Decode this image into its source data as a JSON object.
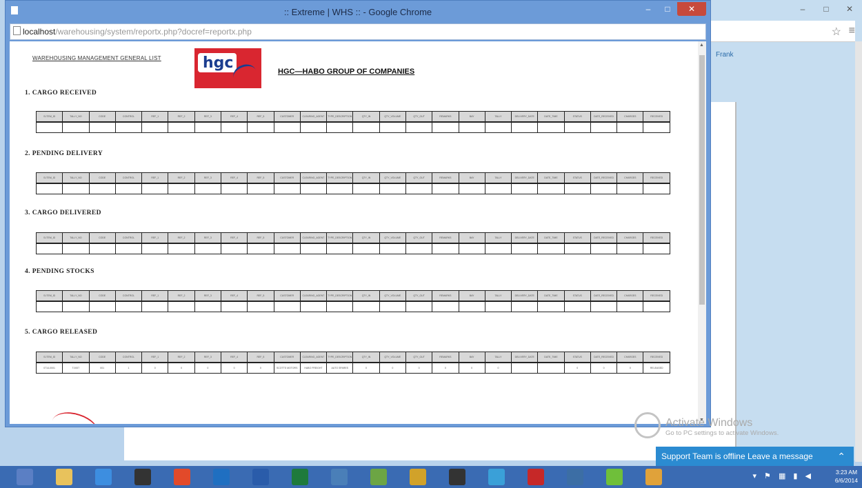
{
  "browser": {
    "window_title": ":: Extreme | WHS :: - Google Chrome",
    "url_host": "localhost",
    "url_path": "/warehousing/system/reportx.php?docref=reportx.php",
    "controls": {
      "minimize": "–",
      "maximize": "□",
      "close": "✕"
    }
  },
  "background_window": {
    "controls": [
      "–",
      "□",
      "✕"
    ],
    "star": "☆",
    "menu": "≡",
    "user_name": "Frank"
  },
  "report": {
    "heading": "WAREHOUSING MANAGEMENT GENERAL LIST",
    "logo_text": "hgc",
    "company_name": "HGC—HABO GROUP OF COMPANIES",
    "columns": [
      "S.ITEM_ID",
      "TALLY_NO",
      "CODE",
      "CONTROL",
      "REF_1",
      "REF_2",
      "REF_3",
      "REF_4",
      "REF_5",
      "CUSTOMER",
      "CLEARING_AGENT",
      "TYPE_DESCRIPTION",
      "QTY_IN",
      "QTY_VOLUME",
      "QTY_OUT",
      "REMARKS",
      "BAY",
      "TALLY",
      "DELIVERY_DATE",
      "DATE_TIME",
      "STATUS",
      "DATE_RECEIVED",
      "CHARGES",
      "RECEIVED"
    ],
    "sections": [
      {
        "title": "1. CARGO RECEIVED",
        "rows": [
          [
            "",
            "",
            "",
            "",
            "",
            "",
            "",
            "",
            "",
            "",
            "",
            "",
            "",
            "",
            "",
            "",
            "",
            "",
            "",
            "",
            "",
            "",
            "",
            ""
          ]
        ]
      },
      {
        "title": "2. PENDING DELIVERY",
        "rows": [
          [
            "",
            "",
            "",
            "",
            "",
            "",
            "",
            "",
            "",
            "",
            "",
            "",
            "",
            "",
            "",
            "",
            "",
            "",
            "",
            "",
            "",
            "",
            "",
            ""
          ]
        ]
      },
      {
        "title": "3. CARGO DELIVERED",
        "rows": [
          [
            "",
            "",
            "",
            "",
            "",
            "",
            "",
            "",
            "",
            "",
            "",
            "",
            "",
            "",
            "",
            "",
            "",
            "",
            "",
            "",
            "",
            "",
            "",
            ""
          ]
        ]
      },
      {
        "title": "4. PENDING STOCKS",
        "rows": [
          [
            "",
            "",
            "",
            "",
            "",
            "",
            "",
            "",
            "",
            "",
            "",
            "",
            "",
            "",
            "",
            "",
            "",
            "",
            "",
            "",
            "",
            "",
            "",
            ""
          ]
        ]
      },
      {
        "title": "5. CARGO RELEASED",
        "rows": [
          [
            "0714-0001",
            "T.0007",
            "001",
            "1",
            "0",
            "0",
            "0",
            "0",
            "0",
            "SCOTTS MOTORS",
            "HABO FREIGHT",
            "AUTO SPARES",
            "0",
            "0",
            "0",
            "0",
            "0",
            "0",
            "",
            "",
            "0",
            "0",
            "0",
            "RELEASED"
          ]
        ]
      }
    ]
  },
  "watermark": {
    "title": "Activate Windows",
    "subtitle": "Go to PC settings to activate Windows."
  },
  "support_bar": {
    "text": "Support Team is offline Leave a message",
    "arrow": "⌃"
  },
  "taskbar": {
    "apps": [
      "windows-explorer",
      "file-manager",
      "internet-explorer",
      "command-prompt",
      "chrome",
      "outlook",
      "word",
      "excel",
      "network-tool",
      "paint",
      "checklist",
      "terminal",
      "browser-app",
      "filezilla",
      "visio",
      "browser-alt",
      "people"
    ],
    "tray": "▾ ⚑ ▦ ▮ ◀",
    "time": "3:23 AM",
    "date": "6/6/2014"
  },
  "colors": {
    "popup_frame": "#6c9bd8",
    "close_button": "#c74a3c",
    "logo_red": "#d92630",
    "logo_blue": "#1b3d8f",
    "taskbar": "#3a6bb3",
    "support": "#2b8bd1"
  }
}
